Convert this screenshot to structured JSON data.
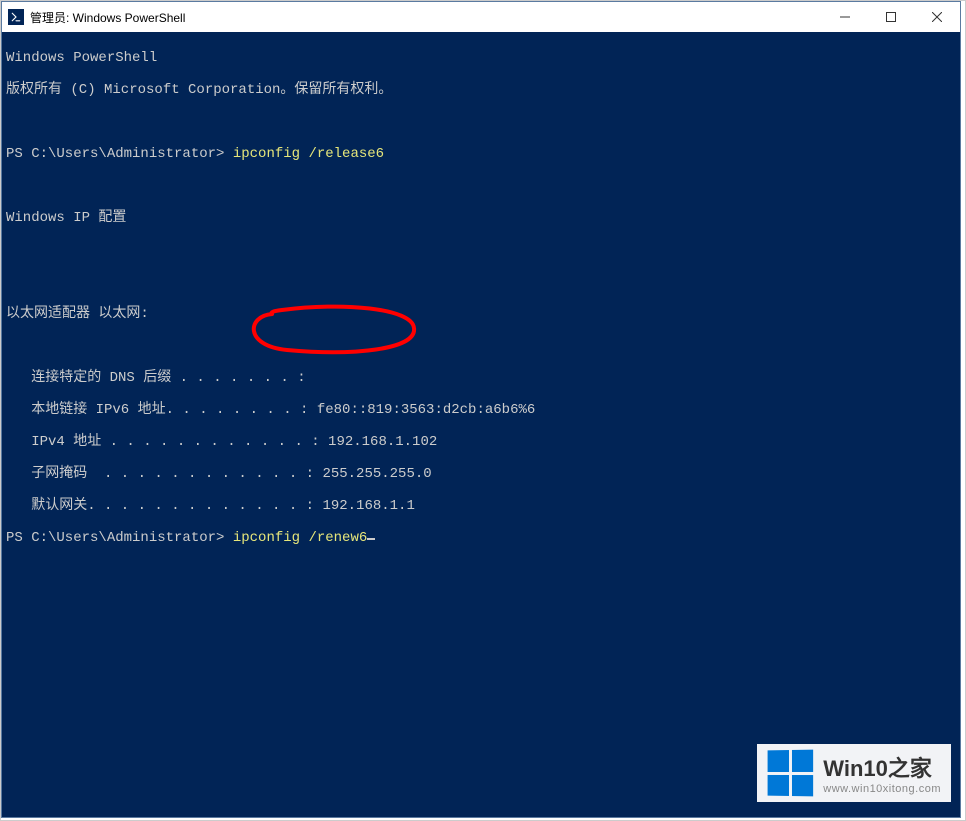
{
  "window": {
    "title": "管理员: Windows PowerShell"
  },
  "terminal": {
    "header1": "Windows PowerShell",
    "header2": "版权所有 (C) Microsoft Corporation。保留所有权利。",
    "prompt1_path": "PS C:\\Users\\Administrator> ",
    "command1": "ipconfig /release6",
    "output_title": "Windows IP 配置",
    "adapter_title": "以太网适配器 以太网:",
    "row_dns": "   连接特定的 DNS 后缀 . . . . . . . :",
    "row_ipv6": "   本地链接 IPv6 地址. . . . . . . . : fe80::819:3563:d2cb:a6b6%6",
    "row_ipv4": "   IPv4 地址 . . . . . . . . . . . . : 192.168.1.102",
    "row_mask": "   子网掩码  . . . . . . . . . . . . : 255.255.255.0",
    "row_gateway": "   默认网关. . . . . . . . . . . . . : 192.168.1.1",
    "prompt2_path": "PS C:\\Users\\Administrator> ",
    "command2": "ipconfig /renew6"
  },
  "watermark": {
    "title": "Win10之家",
    "url": "www.win10xitong.com"
  }
}
